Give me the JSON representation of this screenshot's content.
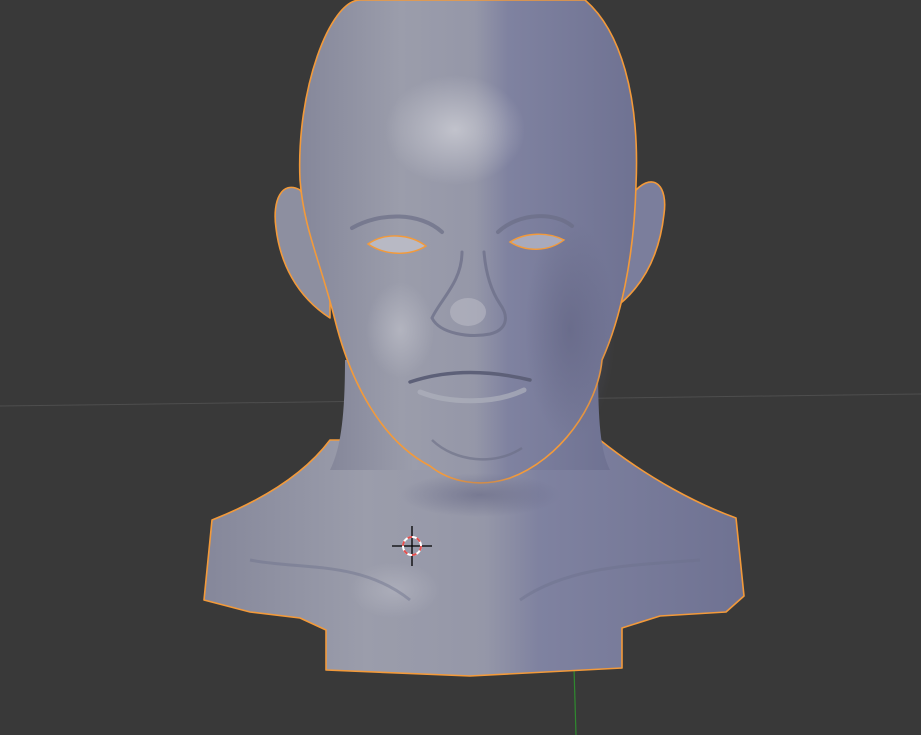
{
  "viewport": {
    "background_color": "#393939",
    "grid_line_color": "#4a4a4a",
    "x_axis_color": "#6a4646",
    "y_axis_color": "#2f8a2f",
    "view_mode": "solid"
  },
  "object": {
    "kind": "sculpted-head-bust-mesh",
    "selected": true,
    "selection_outline_color": "#f39a3a",
    "base_color": "#8f92a5",
    "shadow_color": "#6e7190",
    "highlight_color": "#c7c8d0"
  },
  "cursor_3d": {
    "icon": "3d-cursor-icon",
    "ring_color_a": "#e35050",
    "ring_color_b": "#ffffff",
    "crosshair_color": "#000000"
  }
}
